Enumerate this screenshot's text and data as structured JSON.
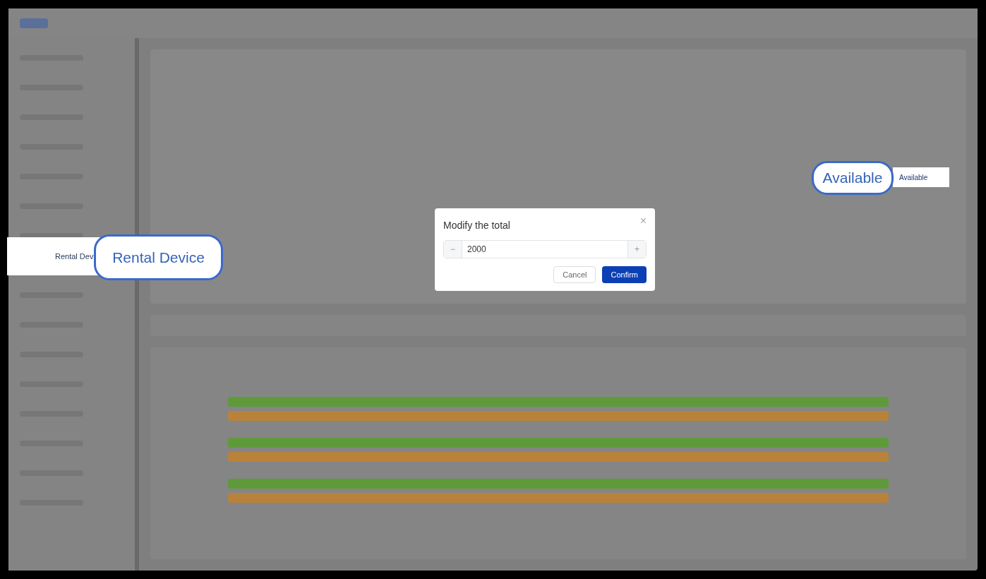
{
  "highlights": [
    {
      "kind": "sidebar",
      "text": "Rental Dev",
      "callout": "Rental Device"
    },
    {
      "kind": "table",
      "text": "Available",
      "callout": "Available"
    }
  ],
  "dialog": {
    "title": "Modify the total",
    "close": "×",
    "minus": "−",
    "value": "2000",
    "plus": "+",
    "buttons": [
      {
        "label": "Cancel",
        "primary": false
      },
      {
        "label": "Confirm",
        "primary": true
      }
    ]
  }
}
